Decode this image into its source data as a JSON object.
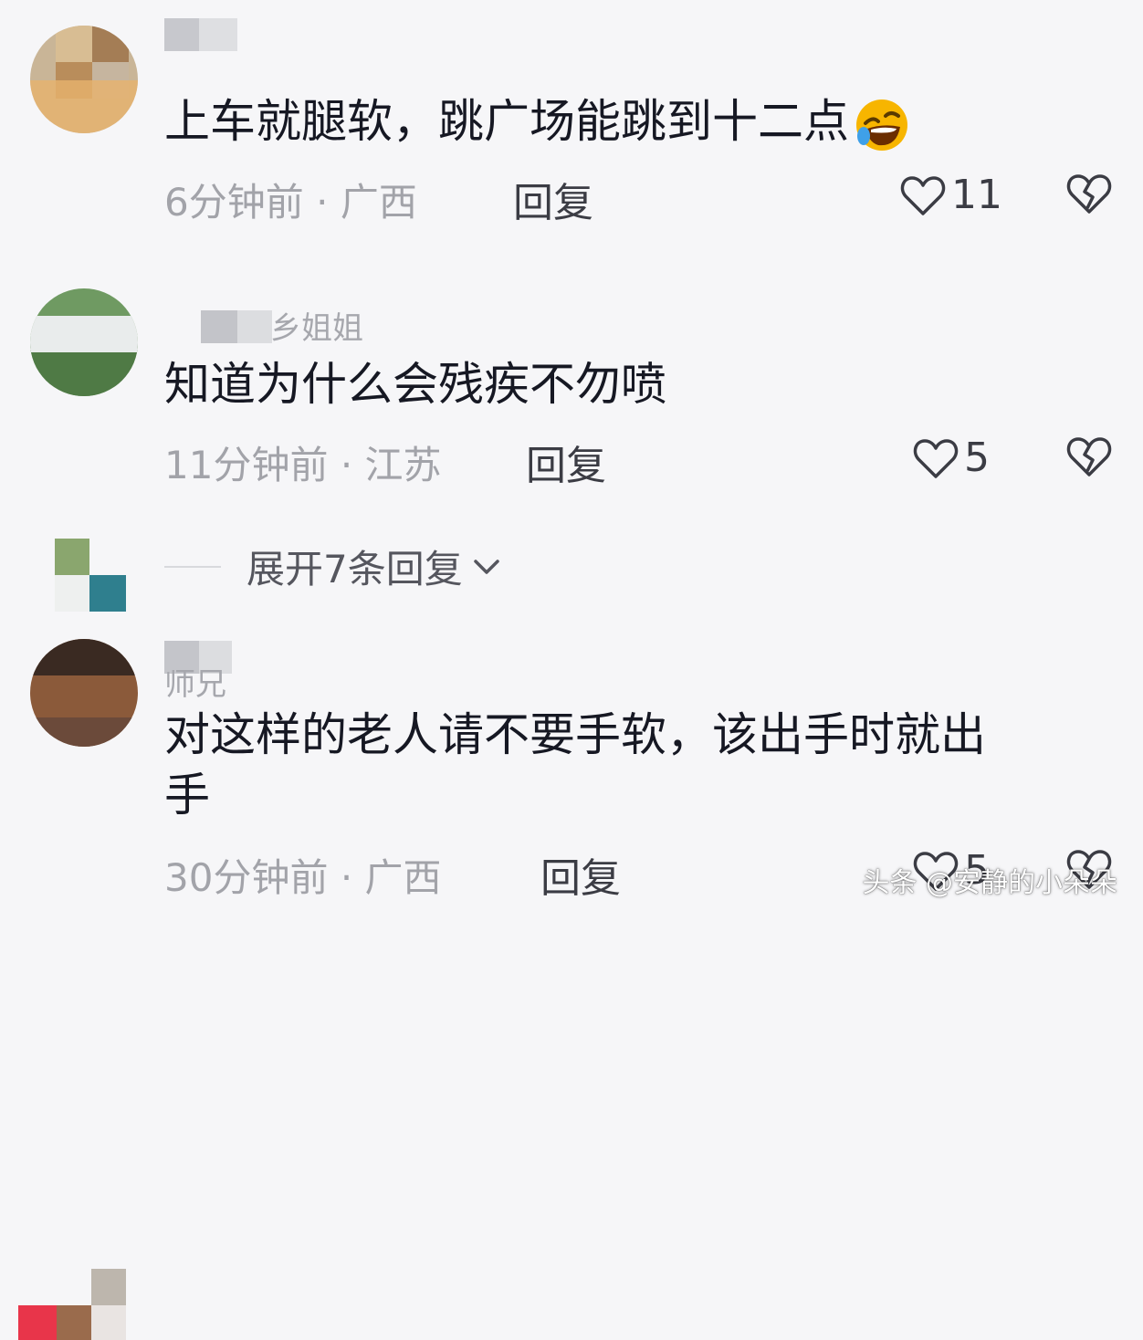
{
  "comments": [
    {
      "username_tail": "",
      "text": "上车就腿软，跳广场能跳到十二点",
      "emoji": "rolling-on-floor-laughing",
      "time": "6分钟前",
      "location": "广西",
      "reply_label": "回复",
      "likes": "11"
    },
    {
      "username_tail": "乡姐姐",
      "text": "知道为什么会残疾不勿喷",
      "time": "11分钟前",
      "location": "江苏",
      "reply_label": "回复",
      "likes": "5"
    },
    {
      "username_tail": "师兄",
      "text_line1": "对这样的老人请不要手软，该出手时就出",
      "text_line2": "手",
      "time": "30分钟前",
      "location": "广西",
      "reply_label": "回复",
      "likes": "5"
    }
  ],
  "expand_replies": {
    "label": "展开7条回复"
  },
  "meta_separator": "·",
  "watermark": "头条 @安静的小朵朵",
  "icons": {
    "like": "heart-outline-icon",
    "dislike": "broken-heart-icon",
    "expand": "chevron-down-icon"
  },
  "colors": {
    "background": "#f6f6f8",
    "text": "#161823",
    "meta": "#a2a3a9",
    "emoji": "#f7b500"
  }
}
